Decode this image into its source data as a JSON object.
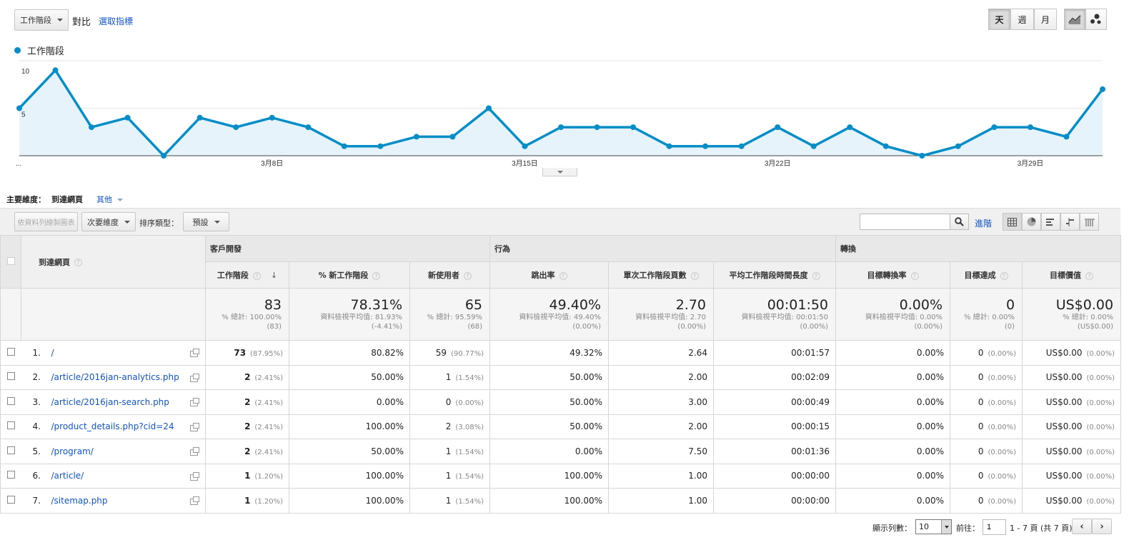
{
  "toolbar": {
    "metric_select": "工作階段",
    "compare_label": "對比",
    "select_metric_link": "選取指標",
    "period_day": "天",
    "period_week": "週",
    "period_month": "月"
  },
  "chart_data": {
    "type": "line",
    "legend": [
      "工作階段"
    ],
    "series": [
      {
        "name": "工作階段",
        "values": [
          5,
          9,
          3,
          4,
          0,
          4,
          3,
          4,
          3,
          1,
          1,
          2,
          2,
          5,
          1,
          3,
          3,
          3,
          1,
          1,
          1,
          3,
          1,
          3,
          1,
          0,
          1,
          3,
          3,
          2,
          7
        ]
      }
    ],
    "x_tick_labels": [
      "...",
      "3月8日",
      "3月15日",
      "3月22日",
      "3月29日"
    ],
    "y_tick_labels": [
      "10",
      "5"
    ],
    "ylim": [
      0,
      10
    ],
    "grid": true,
    "color": "#058dc7"
  },
  "dimension": {
    "label": "主要維度：",
    "current": "到達網頁",
    "other": "其他"
  },
  "filters": {
    "plot_rows_button": "依資料列繪製圖表",
    "secondary_dim": "次要維度",
    "sort_label": "排序類型：",
    "sort_value": "預設",
    "advanced_link": "進階",
    "search_placeholder": ""
  },
  "table": {
    "groups": [
      "客戶開發",
      "行為",
      "轉換"
    ],
    "dim_header": "到達網頁",
    "columns": [
      "工作階段",
      "% 新工作階段",
      "新使用者",
      "跳出率",
      "單次工作階段頁數",
      "平均工作階段時間長度",
      "目標轉換率",
      "目標達成",
      "目標價值"
    ],
    "totals": [
      {
        "value": "83",
        "l1": "% 總計: 100.00%",
        "l2": "(83)"
      },
      {
        "value": "78.31%",
        "l1": "資料檢視平均值: 81.93%",
        "l2": "(-4.41%)"
      },
      {
        "value": "65",
        "l1": "% 總計: 95.59%",
        "l2": "(68)"
      },
      {
        "value": "49.40%",
        "l1": "資料檢視平均值: 49.40%",
        "l2": "(0.00%)"
      },
      {
        "value": "2.70",
        "l1": "資料檢視平均值: 2.70",
        "l2": "(0.00%)"
      },
      {
        "value": "00:01:50",
        "l1": "資料檢視平均值: 00:01:50",
        "l2": "(0.00%)"
      },
      {
        "value": "0.00%",
        "l1": "資料檢視平均值: 0.00%",
        "l2": "(0.00%)"
      },
      {
        "value": "0",
        "l1": "% 總計: 0.00%",
        "l2": "(0)"
      },
      {
        "value": "US$0.00",
        "l1": "% 總計: 0.00%",
        "l2": "(US$0.00)"
      }
    ],
    "rows": [
      {
        "num": "1.",
        "page": "/",
        "sessions": "73",
        "sessions_pct": "(87.95%)",
        "new_pct": "80.82%",
        "new_users": "59",
        "new_users_pct": "(90.77%)",
        "bounce": "49.32%",
        "pages": "2.64",
        "duration": "00:01:57",
        "conv": "0.00%",
        "goals": "0",
        "goals_pct": "(0.00%)",
        "value": "US$0.00",
        "value_pct": "(0.00%)"
      },
      {
        "num": "2.",
        "page": "/article/2016jan-analytics.php",
        "sessions": "2",
        "sessions_pct": "(2.41%)",
        "new_pct": "50.00%",
        "new_users": "1",
        "new_users_pct": "(1.54%)",
        "bounce": "50.00%",
        "pages": "2.00",
        "duration": "00:02:09",
        "conv": "0.00%",
        "goals": "0",
        "goals_pct": "(0.00%)",
        "value": "US$0.00",
        "value_pct": "(0.00%)"
      },
      {
        "num": "3.",
        "page": "/article/2016jan-search.php",
        "sessions": "2",
        "sessions_pct": "(2.41%)",
        "new_pct": "0.00%",
        "new_users": "0",
        "new_users_pct": "(0.00%)",
        "bounce": "50.00%",
        "pages": "3.00",
        "duration": "00:00:49",
        "conv": "0.00%",
        "goals": "0",
        "goals_pct": "(0.00%)",
        "value": "US$0.00",
        "value_pct": "(0.00%)"
      },
      {
        "num": "4.",
        "page": "/product_details.php?cid=24",
        "sessions": "2",
        "sessions_pct": "(2.41%)",
        "new_pct": "100.00%",
        "new_users": "2",
        "new_users_pct": "(3.08%)",
        "bounce": "50.00%",
        "pages": "2.00",
        "duration": "00:00:15",
        "conv": "0.00%",
        "goals": "0",
        "goals_pct": "(0.00%)",
        "value": "US$0.00",
        "value_pct": "(0.00%)"
      },
      {
        "num": "5.",
        "page": "/program/",
        "sessions": "2",
        "sessions_pct": "(2.41%)",
        "new_pct": "50.00%",
        "new_users": "1",
        "new_users_pct": "(1.54%)",
        "bounce": "0.00%",
        "pages": "7.50",
        "duration": "00:01:36",
        "conv": "0.00%",
        "goals": "0",
        "goals_pct": "(0.00%)",
        "value": "US$0.00",
        "value_pct": "(0.00%)"
      },
      {
        "num": "6.",
        "page": "/article/",
        "sessions": "1",
        "sessions_pct": "(1.20%)",
        "new_pct": "100.00%",
        "new_users": "1",
        "new_users_pct": "(1.54%)",
        "bounce": "100.00%",
        "pages": "1.00",
        "duration": "00:00:00",
        "conv": "0.00%",
        "goals": "0",
        "goals_pct": "(0.00%)",
        "value": "US$0.00",
        "value_pct": "(0.00%)"
      },
      {
        "num": "7.",
        "page": "/sitemap.php",
        "sessions": "1",
        "sessions_pct": "(1.20%)",
        "new_pct": "100.00%",
        "new_users": "1",
        "new_users_pct": "(1.54%)",
        "bounce": "100.00%",
        "pages": "1.00",
        "duration": "00:00:00",
        "conv": "0.00%",
        "goals": "0",
        "goals_pct": "(0.00%)",
        "value": "US$0.00",
        "value_pct": "(0.00%)"
      }
    ]
  },
  "pagination": {
    "rows_label": "顯示列數：",
    "rows_value": "10",
    "goto_label": "前往：",
    "goto_value": "1",
    "range_text": "1 - 7 頁 (共 7 頁)"
  }
}
